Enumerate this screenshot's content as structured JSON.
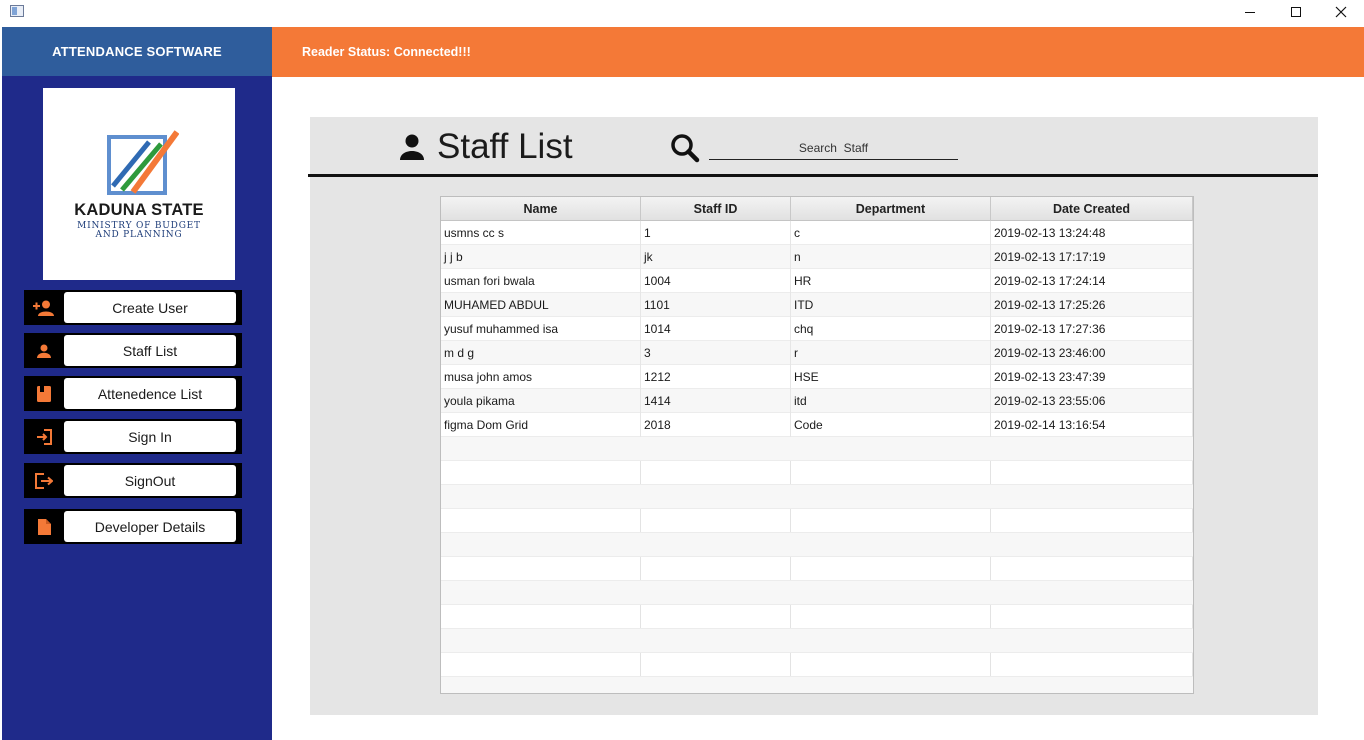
{
  "sidebar": {
    "title": "ATTENDANCE SOFTWARE",
    "logo": {
      "title": "KADUNA STATE",
      "subtitle_line1": "MINISTRY OF BUDGET",
      "subtitle_line2": "AND PLANNING",
      "colors": {
        "orange": "#f47937",
        "blue": "#2f6ab3",
        "green": "#2e9a3c",
        "frame": "#5f8fcf"
      }
    },
    "menu": [
      {
        "label": "Create User",
        "icon": "add-user-icon"
      },
      {
        "label": "Staff List",
        "icon": "user-icon"
      },
      {
        "label": "Attenedence List",
        "icon": "book-icon"
      },
      {
        "label": "Sign In",
        "icon": "sign-in-icon"
      },
      {
        "label": "SignOut",
        "icon": "sign-out-icon"
      },
      {
        "label": "Developer Details",
        "icon": "document-icon"
      }
    ]
  },
  "header": {
    "status": "Reader Status: Connected!!!"
  },
  "page": {
    "title": "Staff List",
    "search_placeholder": "Search  Staff"
  },
  "table": {
    "columns": [
      "Name",
      "Staff ID",
      "Department",
      "Date Created"
    ],
    "rows": [
      [
        "usmns cc s",
        "1",
        "c",
        "2019-02-13 13:24:48"
      ],
      [
        "j j b",
        "jk",
        "n",
        "2019-02-13 17:17:19"
      ],
      [
        "usman fori bwala",
        "1004",
        "HR",
        "2019-02-13 17:24:14"
      ],
      [
        "MUHAMED ABDUL",
        "1101",
        "ITD",
        "2019-02-13 17:25:26"
      ],
      [
        "yusuf muhammed isa",
        "1014",
        "chq",
        "2019-02-13 17:27:36"
      ],
      [
        "m d g",
        "3",
        "r",
        "2019-02-13 23:46:00"
      ],
      [
        "musa john amos",
        "1212",
        "HSE",
        "2019-02-13 23:47:39"
      ],
      [
        "youla pikama",
        "1414",
        "itd",
        "2019-02-13 23:55:06"
      ],
      [
        "figma Dom Grid",
        "2018",
        "Code",
        "2019-02-14 13:16:54"
      ]
    ]
  },
  "colors": {
    "sidebar": "#1f2a8a",
    "sidebar_head": "#2f5d9c",
    "accent": "#f47937",
    "panel": "#e5e5e5"
  }
}
